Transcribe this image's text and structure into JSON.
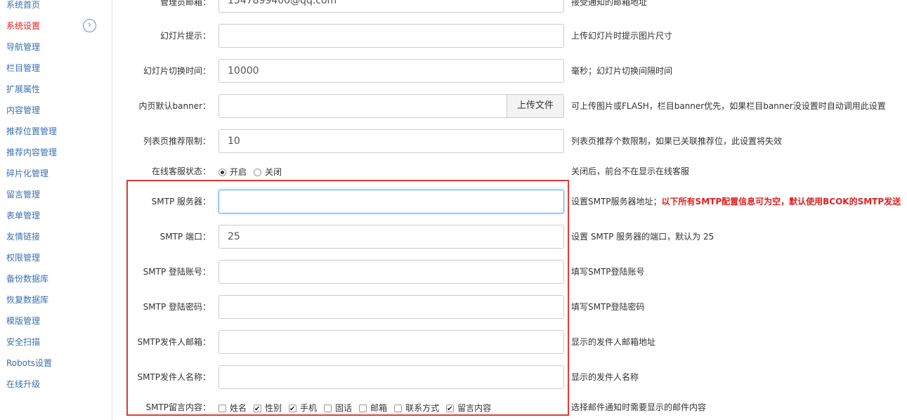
{
  "sidebar": {
    "items": [
      {
        "label": "系统首页",
        "active": false
      },
      {
        "label": "系统设置",
        "active": true
      },
      {
        "label": "导航管理",
        "active": false
      },
      {
        "label": "栏目管理",
        "active": false
      },
      {
        "label": "扩展属性",
        "active": false
      },
      {
        "label": "内容管理",
        "active": false
      },
      {
        "label": "推荐位置管理",
        "active": false
      },
      {
        "label": "推荐内容管理",
        "active": false
      },
      {
        "label": "碎片化管理",
        "active": false
      },
      {
        "label": "留言管理",
        "active": false
      },
      {
        "label": "表单管理",
        "active": false
      },
      {
        "label": "友情链接",
        "active": false
      },
      {
        "label": "权限管理",
        "active": false
      },
      {
        "label": "备份数据库",
        "active": false
      },
      {
        "label": "恢复数据库",
        "active": false
      },
      {
        "label": "模版管理",
        "active": false
      },
      {
        "label": "安全扫描",
        "active": false
      },
      {
        "label": "Robots设置",
        "active": false
      },
      {
        "label": "在线升级",
        "active": false
      }
    ],
    "arrow_icon": "chevron-right-circle-icon"
  },
  "form": {
    "admin_email": {
      "label": "管理员邮箱：",
      "value": "1547899400@qq.com",
      "hint": "接受通知的邮箱地址"
    },
    "slide_tip": {
      "label": "幻灯片提示：",
      "value": "",
      "hint": "上传幻灯片时提示图片尺寸"
    },
    "slide_interval": {
      "label": "幻灯片切换时间：",
      "value": "10000",
      "hint": "毫秒；幻灯片切换间隔时间"
    },
    "inner_banner": {
      "label": "内页默认banner：",
      "value": "",
      "button": "上传文件",
      "hint": "可上传图片或FLASH，栏目banner优先，如果栏目banner没设置时自动调用此设置"
    },
    "list_limit": {
      "label": "列表页推荐限制：",
      "value": "10",
      "hint": "列表页推荐个数限制，如果已关联推荐位，此设置将失效"
    },
    "online_service": {
      "label": "在线客服状态：",
      "options": [
        "开启",
        "关闭"
      ],
      "selected": "开启",
      "hint": "关闭后，前台不在显示在线客服"
    },
    "smtp_server": {
      "label": "SMTP 服务器：",
      "value": "",
      "hint": "设置SMTP服务器地址；",
      "hint_red": "以下所有SMTP配置信息可为空，默认使用BCOK的SMTP发送"
    },
    "smtp_port": {
      "label": "SMTP 端口：",
      "value": "25",
      "hint": "设置 SMTP 服务器的端口，默认为 25"
    },
    "smtp_account": {
      "label": "SMTP 登陆账号：",
      "value": "",
      "hint": "填写SMTP登陆账号"
    },
    "smtp_password": {
      "label": "SMTP 登陆密码：",
      "value": "",
      "hint": "填写SMTP登陆密码"
    },
    "smtp_sender_email": {
      "label": "SMTP发件人邮箱：",
      "value": "",
      "hint": "显示的发件人邮箱地址"
    },
    "smtp_sender_name": {
      "label": "SMTP发件人名称：",
      "value": "",
      "hint": "显示的发件人名称"
    },
    "smtp_message": {
      "label": "SMTP留言内容：",
      "options": [
        {
          "label": "姓名",
          "checked": false
        },
        {
          "label": "性别",
          "checked": true
        },
        {
          "label": "手机",
          "checked": true
        },
        {
          "label": "固话",
          "checked": false
        },
        {
          "label": "邮箱",
          "checked": false
        },
        {
          "label": "联系方式",
          "checked": false
        },
        {
          "label": "留言内容",
          "checked": true
        }
      ],
      "hint": "选择邮件通知时需要显示的邮件内容"
    }
  },
  "colors": {
    "accent": "#3a6fb0",
    "active": "#e02020",
    "highlight_box": "#e53935",
    "focus": "#66afe9"
  }
}
